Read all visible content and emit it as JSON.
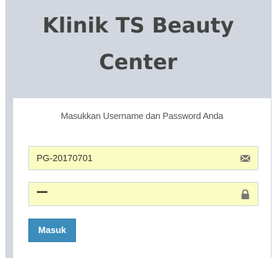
{
  "header": {
    "line1": "Klinik TS Beauty",
    "line2": "Center"
  },
  "login": {
    "message": "Masukkan Username dan Password Anda",
    "username_value": "PG-20170701",
    "password_mask": "••••••",
    "submit_label": "Masuk",
    "username_icon": "envelope-icon",
    "password_icon": "lock-icon"
  }
}
